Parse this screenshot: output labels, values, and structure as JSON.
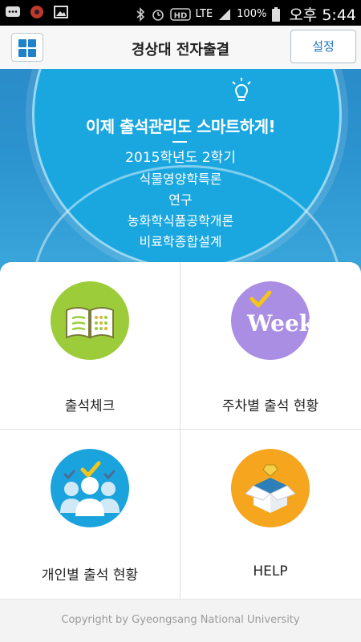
{
  "status_bar": {
    "lte": "LTE",
    "battery": "100%",
    "time": "오후 5:44"
  },
  "appbar": {
    "title": "경상대 전자출결",
    "settings_label": "설정"
  },
  "banner": {
    "headline": "이제 출석관리도 스마트하게!",
    "semester": "2015학년도 2학기",
    "courses": [
      "식물영양학특론",
      "연구",
      "농화학식품공학개론",
      "비료학종합설계"
    ]
  },
  "menu": [
    {
      "label": "출석체크",
      "icon": "open-book-icon",
      "color": "#9ccc3a"
    },
    {
      "label": "주차별 출석 현황",
      "icon": "week-check-icon",
      "color": "#a98ee3",
      "icon_text": "Week"
    },
    {
      "label": "개인별 출석 현황",
      "icon": "people-check-icon",
      "color": "#1aa3dd"
    },
    {
      "label": "HELP",
      "icon": "help-box-icon",
      "color": "#f5a51e"
    }
  ],
  "footer": {
    "copyright": "Copyright by Gyeongsang National University"
  }
}
